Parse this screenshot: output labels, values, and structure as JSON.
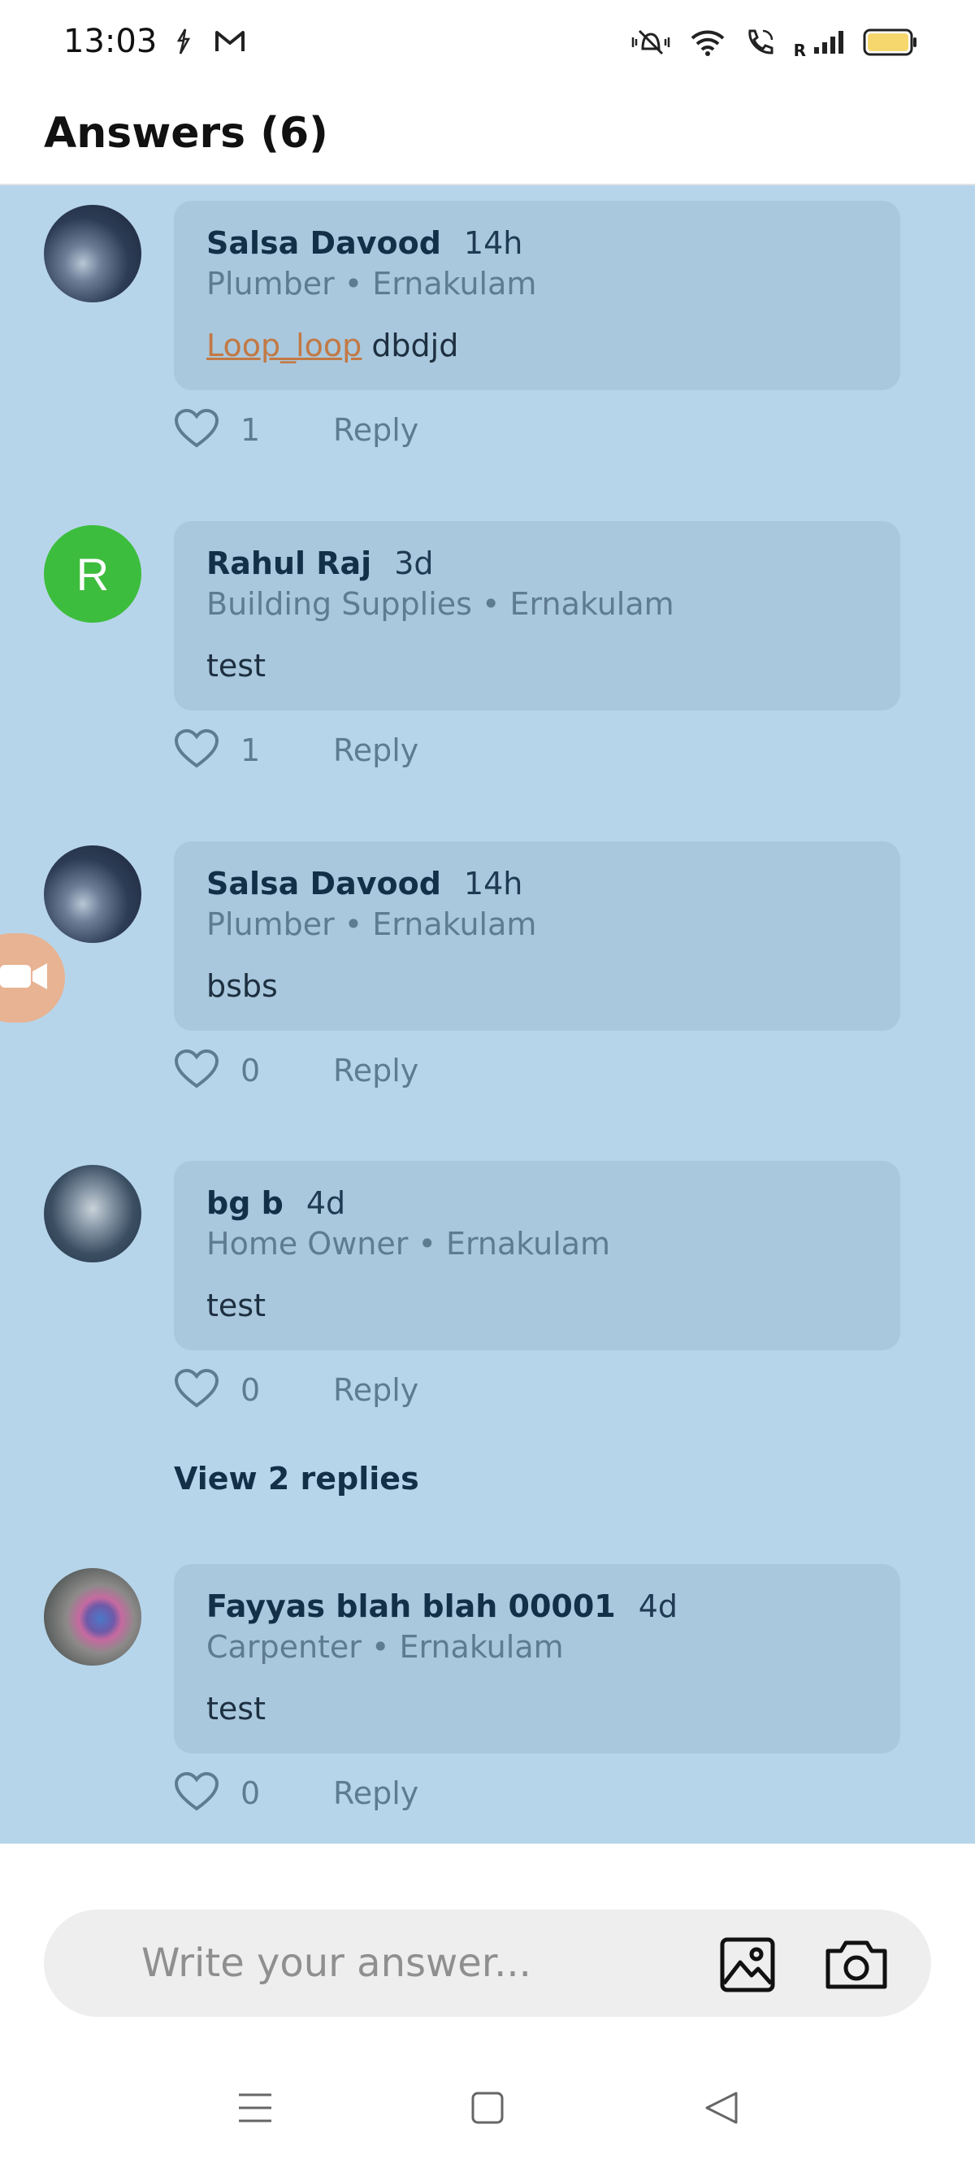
{
  "status_bar": {
    "time": "13:03",
    "icons": [
      "sync-icon",
      "gmail-icon",
      "mute-icon",
      "wifi-icon",
      "wifi-calling-icon",
      "signal-icon",
      "battery-icon"
    ],
    "roaming_label": "R",
    "battery_color": "#f5d76e"
  },
  "header": {
    "title": "Answers (6)"
  },
  "colors": {
    "feed_overlay": "#b7d5ea",
    "bubble": "#a9c8dd",
    "avatar_letter_bg": "#3dbd3d",
    "mention": "#c27945"
  },
  "answers": [
    {
      "author": "Salsa Davood",
      "time": "14h",
      "meta": "Plumber • Ernakulam",
      "mention": "Loop_loop",
      "text": "dbdjd",
      "likes": "1",
      "reply_label": "Reply"
    },
    {
      "author": "Rahul Raj",
      "avatar_letter": "R",
      "time": "3d",
      "meta": "Building Supplies • Ernakulam",
      "text": "test",
      "likes": "1",
      "reply_label": "Reply"
    },
    {
      "author": "Salsa Davood",
      "time": "14h",
      "meta": "Plumber • Ernakulam",
      "text": "bsbs",
      "likes": "0",
      "reply_label": "Reply"
    },
    {
      "author": "bg b",
      "time": "4d",
      "meta": "Home Owner • Ernakulam",
      "text": "test",
      "likes": "0",
      "reply_label": "Reply",
      "view_replies": "View 2 replies"
    },
    {
      "author": "Fayyas blah blah 00001",
      "time": "4d",
      "meta": "Carpenter • Ernakulam",
      "text": "test",
      "likes": "0",
      "reply_label": "Reply"
    }
  ],
  "composer": {
    "placeholder": "Write your answer...",
    "value": ""
  },
  "nav": {
    "buttons": [
      "menu-icon",
      "home-square-icon",
      "back-triangle-icon"
    ]
  }
}
